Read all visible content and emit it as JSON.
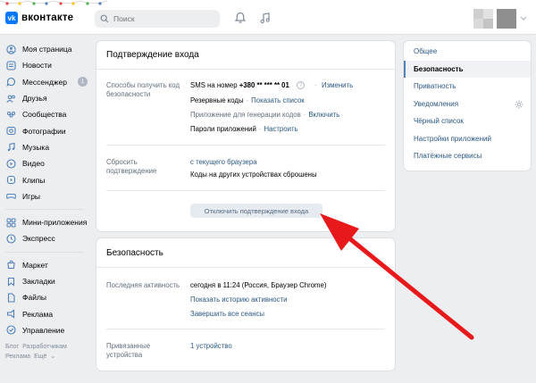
{
  "header": {
    "logo_mark": "vk",
    "logo_text": "вконтакте",
    "search_placeholder": "Поиск"
  },
  "sidebar": {
    "items": [
      {
        "label": "Моя страница",
        "icon": "user-circle-icon"
      },
      {
        "label": "Новости",
        "icon": "news-icon"
      },
      {
        "label": "Мессенджер",
        "icon": "chat-icon",
        "badge": "1"
      },
      {
        "label": "Друзья",
        "icon": "friends-icon"
      },
      {
        "label": "Сообщества",
        "icon": "groups-icon"
      },
      {
        "label": "Фотографии",
        "icon": "photo-icon"
      },
      {
        "label": "Музыка",
        "icon": "music-icon"
      },
      {
        "label": "Видео",
        "icon": "video-icon"
      },
      {
        "label": "Клипы",
        "icon": "clips-icon"
      },
      {
        "label": "Игры",
        "icon": "games-icon"
      }
    ],
    "items2": [
      {
        "label": "Мини-приложения",
        "icon": "apps-icon"
      },
      {
        "label": "Экспресс",
        "icon": "express-icon"
      }
    ],
    "items3": [
      {
        "label": "Маркет",
        "icon": "market-icon"
      },
      {
        "label": "Закладки",
        "icon": "bookmark-icon"
      },
      {
        "label": "Файлы",
        "icon": "files-icon"
      },
      {
        "label": "Реклама",
        "icon": "ads-icon"
      },
      {
        "label": "Управление",
        "icon": "manage-icon"
      }
    ],
    "footer": {
      "blog": "Блог",
      "developers": "Разработчикам",
      "ads": "Реклама",
      "more": "Ещё"
    }
  },
  "login_confirm": {
    "title": "Подтверждение входа",
    "methods_label": "Способы получить код безопасности",
    "sms_prefix": "SMS на номер",
    "sms_number": "+380 ** *** ** 01",
    "change_link": "Изменить",
    "backup_codes": "Резервные коды",
    "show_list_link": "Показать список",
    "app_codes": "Приложение для генерации кодов",
    "enable_link": "Включить",
    "app_passwords": "Пароли приложений",
    "configure_link": "Настроить",
    "reset_label": "Сбросить подтверждение",
    "from_browser_link": "с текущего браузера",
    "codes_reset_text": "Коды на других устройствах сброшены",
    "disable_button": "Отключить подтверждение входа"
  },
  "security": {
    "title": "Безопасность",
    "last_activity_label": "Последняя активность",
    "last_activity_value": "сегодня в 11:24 (Россия, Браузер Chrome)",
    "history_link": "Показать историю активности",
    "end_sessions_link": "Завершить все сеансы",
    "devices_label": "Привязанные устройства",
    "devices_link": "1 устройство"
  },
  "right_menu": {
    "items": [
      {
        "label": "Общее"
      },
      {
        "label": "Безопасность",
        "active": true
      },
      {
        "label": "Приватность"
      },
      {
        "label": "Уведомления"
      },
      {
        "label": "Чёрный список"
      },
      {
        "label": "Настройки приложений"
      },
      {
        "label": "Платёжные сервисы"
      }
    ]
  },
  "colors": {
    "accent": "#2a5885",
    "brand": "#0077ff",
    "annotation_arrow": "#e8191b"
  }
}
